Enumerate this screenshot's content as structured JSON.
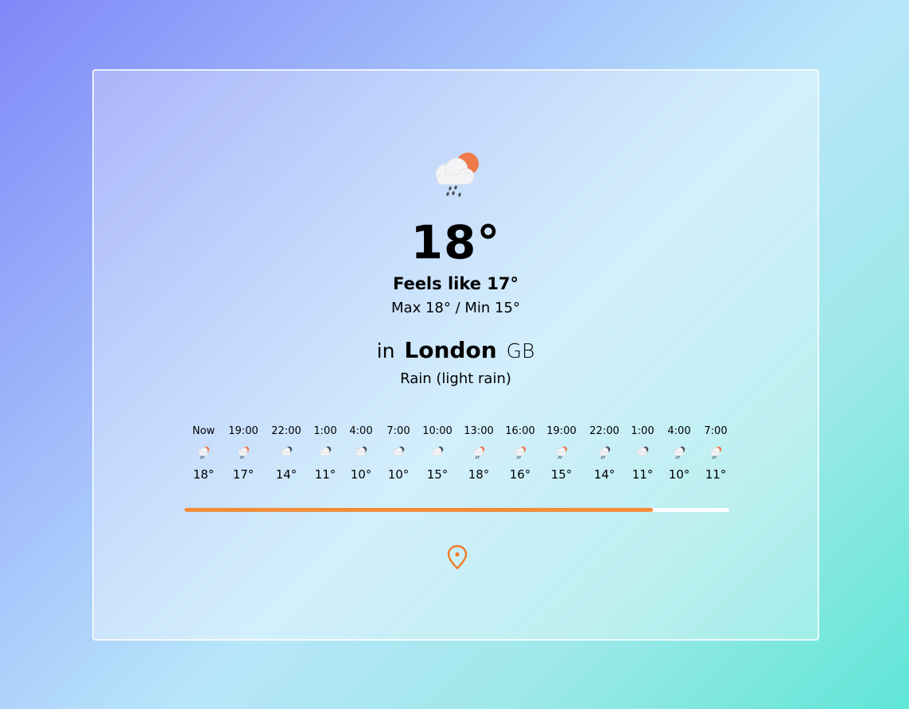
{
  "current": {
    "temp": "18°",
    "feels_like": "Feels like 17°",
    "max_min": "Max 18° / Min 15°",
    "location_prefix": "in",
    "city": "London",
    "country": "GB",
    "description": "Rain (light rain)",
    "icon": "rain-sun-icon"
  },
  "forecast": [
    {
      "time": "Now",
      "temp": "18°",
      "icon": "rain-sun-icon"
    },
    {
      "time": "19:00",
      "temp": "17°",
      "icon": "rain-sun-icon"
    },
    {
      "time": "22:00",
      "temp": "14°",
      "icon": "cloud-moon-icon"
    },
    {
      "time": "1:00",
      "temp": "11°",
      "icon": "cloud-moon-icon"
    },
    {
      "time": "4:00",
      "temp": "10°",
      "icon": "cloud-moon-icon"
    },
    {
      "time": "7:00",
      "temp": "10°",
      "icon": "cloud-moon-icon"
    },
    {
      "time": "10:00",
      "temp": "15°",
      "icon": "cloud-moon-icon"
    },
    {
      "time": "13:00",
      "temp": "18°",
      "icon": "rain-sun-icon"
    },
    {
      "time": "16:00",
      "temp": "16°",
      "icon": "rain-sun-icon"
    },
    {
      "time": "19:00",
      "temp": "15°",
      "icon": "rain-sun-icon"
    },
    {
      "time": "22:00",
      "temp": "14°",
      "icon": "rain-moon-icon"
    },
    {
      "time": "1:00",
      "temp": "11°",
      "icon": "cloud-moon-icon"
    },
    {
      "time": "4:00",
      "temp": "10°",
      "icon": "rain-moon-icon"
    },
    {
      "time": "7:00",
      "temp": "11°",
      "icon": "rain-sun-icon"
    }
  ],
  "progress": {
    "fraction": 0.86
  },
  "colors": {
    "accent": "#f28c3a",
    "sun": "#f07a4a",
    "cloud": "#f4f4f6",
    "rain": "#4a4d57",
    "pin": "#f07a2a"
  }
}
